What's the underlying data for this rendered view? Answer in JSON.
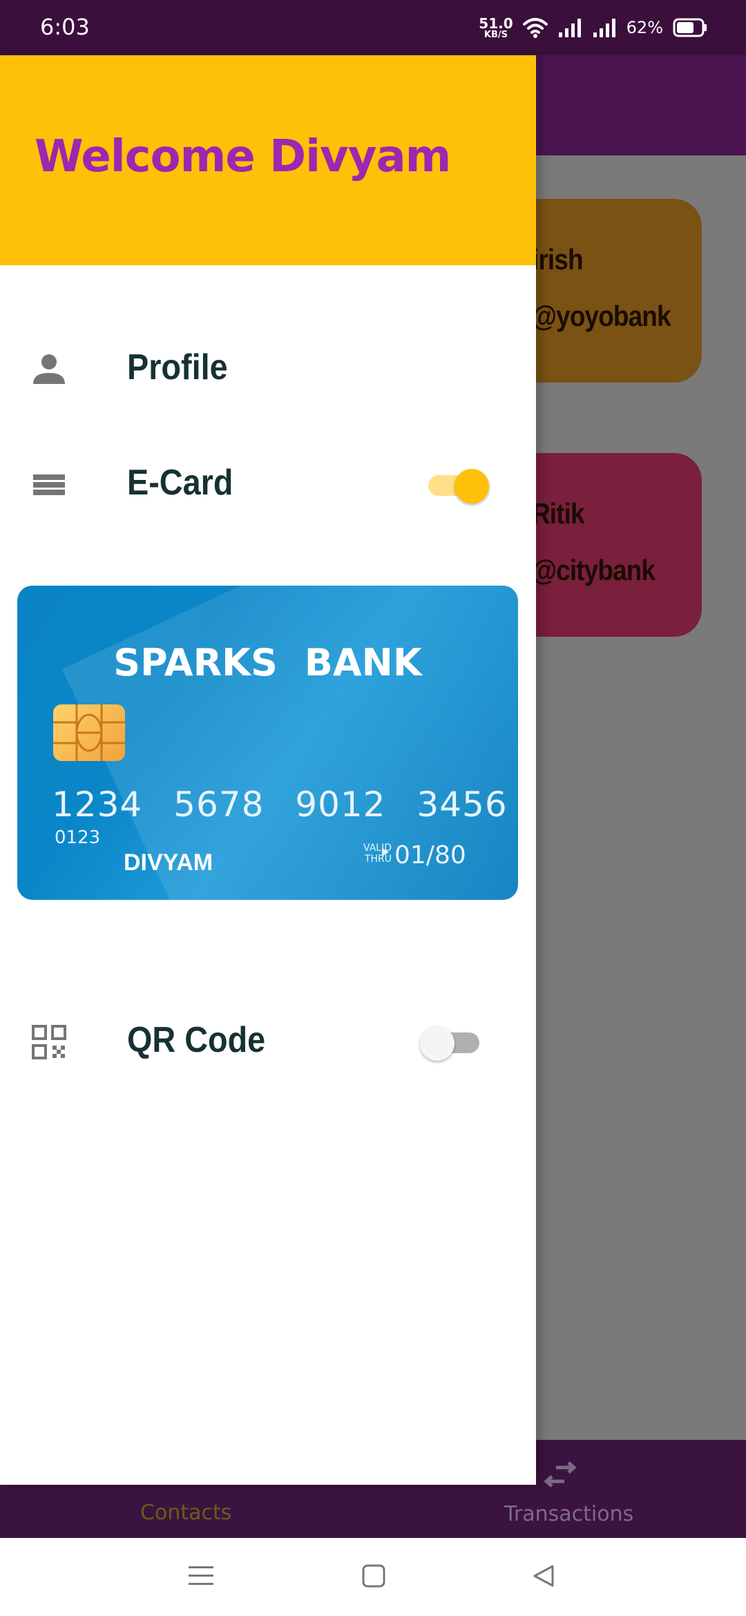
{
  "status_bar": {
    "time": "6:03",
    "net_speed_value": "51.0",
    "net_speed_unit": "KB/S",
    "battery_percent": "62%"
  },
  "background": {
    "contacts": [
      {
        "name": "irish",
        "bank": "@yoyobank"
      },
      {
        "name": "Ritik",
        "bank": "@citybank"
      }
    ],
    "bottom_nav": {
      "contacts_label": "Contacts",
      "transactions_label": "Transactions"
    }
  },
  "drawer": {
    "welcome": "Welcome Divyam",
    "menu": {
      "profile_label": "Profile",
      "ecard_label": "E-Card",
      "ecard_enabled": true,
      "qr_label": "QR Code",
      "qr_enabled": false
    },
    "card": {
      "bank_name": "SPARKS BANK",
      "number": "1234 5678 9012 3456",
      "sub_number": "0123",
      "holder": "DIVYAM",
      "valid_line1": "VALID",
      "valid_line2": "THRU",
      "expiry": "01/80"
    }
  },
  "colors": {
    "header_yellow": "#ffc107",
    "welcome_purple": "#9c27b0",
    "status_bar": "#3b0f3b",
    "card_blue": "#0a86c8"
  },
  "icons": {
    "profile": "person-icon",
    "ecard": "card-icon",
    "qr": "qr-code-icon",
    "transactions": "swap-arrows-icon",
    "contacts": "contacts-icon"
  }
}
